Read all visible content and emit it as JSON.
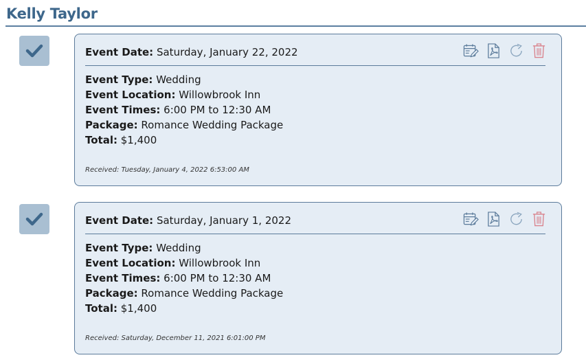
{
  "page": {
    "title": "Kelly Taylor"
  },
  "labels": {
    "event_date": "Event Date:",
    "event_type": "Event Type:",
    "event_location": "Event Location:",
    "event_times": "Event Times:",
    "package": "Package:",
    "total": "Total:"
  },
  "colors": {
    "accent": "#3e678b",
    "card_bg": "#e5edf5",
    "check_bg": "#a9bfd2",
    "delete": "#d9828c"
  },
  "icons": [
    "edit-calendar-icon",
    "pdf-icon",
    "refresh-icon",
    "trash-icon"
  ],
  "events": [
    {
      "checked": true,
      "event_date": "Saturday, January 22, 2022",
      "event_type": "Wedding",
      "event_location": "Willowbrook Inn",
      "event_times": "6:00 PM to 12:30 AM",
      "package": "Romance Wedding Package",
      "total": "$1,400",
      "received": "Received: Tuesday, January 4, 2022 6:53:00 AM"
    },
    {
      "checked": true,
      "event_date": "Saturday, January 1, 2022",
      "event_type": "Wedding",
      "event_location": "Willowbrook Inn",
      "event_times": "6:00 PM to 12:30 AM",
      "package": "Romance Wedding Package",
      "total": "$1,400",
      "received": "Received: Saturday, December 11, 2021 6:01:00 PM"
    }
  ]
}
